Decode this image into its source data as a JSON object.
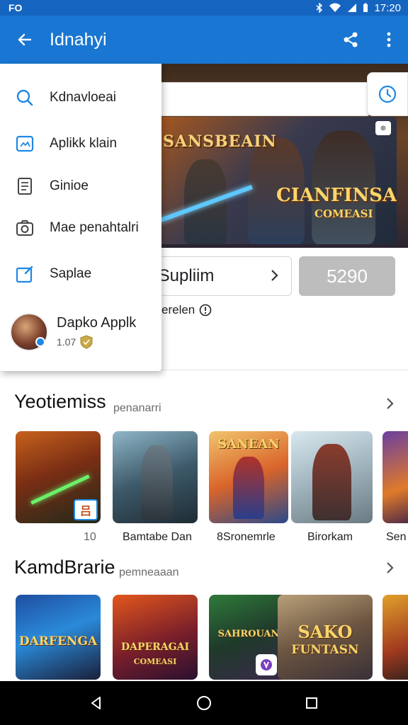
{
  "status_bar": {
    "left": "FO",
    "time": "17:20"
  },
  "app_bar": {
    "title": "Idnahyi"
  },
  "drawer": {
    "items": [
      {
        "label": "Kdnavloeai",
        "icon": "search-icon"
      },
      {
        "label": "Aplikk klain",
        "icon": "image-icon"
      },
      {
        "label": "Ginioe",
        "icon": "document-icon"
      },
      {
        "label": "Mae penahtalri",
        "icon": "camera-icon"
      },
      {
        "label": "Saplae",
        "icon": "edit-icon"
      }
    ],
    "profile": {
      "name": "Dapko Applk",
      "sub": "1.07"
    }
  },
  "hero": {
    "banner_left": "SANSBEAIN",
    "banner_title": "CIANFINSAI",
    "banner_sub": "COMEASI",
    "supplier_label": "Supliim",
    "supplier_prefix": ")",
    "price": "5290",
    "meta": "erelen"
  },
  "section1": {
    "title": "Yeotiemiss",
    "sub": "penanarri",
    "tiles": [
      {
        "label": "",
        "corner": "10"
      },
      {
        "label": "Bamtabe Dan"
      },
      {
        "label": "8Sronemrle",
        "name": "SANEAN"
      },
      {
        "label": "Birorkam"
      },
      {
        "label": "Sen"
      }
    ]
  },
  "section2": {
    "title": "KamdBrarie",
    "sub": "pemneaaan",
    "tiles": [
      {
        "name": "DARFENGA"
      },
      {
        "name": "DAPERAGAI",
        "sub": "COMEASI"
      },
      {
        "name": "SAHROUAN"
      },
      {
        "name": "SAKO",
        "sub": "FUNTASN"
      },
      {
        "name": ""
      }
    ]
  },
  "colors": {
    "app_bar": "#1976d2",
    "status_bar": "#1565c0",
    "accent": "#1e88e5"
  }
}
